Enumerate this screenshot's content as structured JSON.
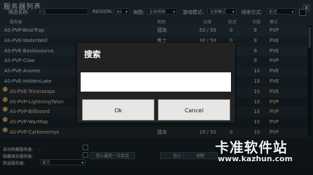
{
  "window": {
    "title": "服务器列表",
    "close_label": "X"
  },
  "filters": {
    "name_label": "筛选名称:",
    "name_placeholder": "筛选",
    "region_label": "REGION:",
    "region_value": "AS",
    "map_label": "地图:",
    "map_value": "全部地图",
    "mode_label": "游戏模式:",
    "mode_value": "全部模式",
    "sort_label": "排序方式:",
    "sort_value": "延迟"
  },
  "table": {
    "headers": {
      "server": "服务器",
      "map": "地图",
      "players": "玩家",
      "latency": "延迟",
      "days": "天数",
      "mode": "模式"
    },
    "rows": [
      {
        "name": "AS-PVP-BearTrap",
        "map": "孤岛",
        "players": "50 / 50",
        "latency": "0",
        "days": "9",
        "mode": "PVP",
        "official": false
      },
      {
        "name": "AS-PVE-WaterWell",
        "map": "焦土",
        "players": "30 / 50",
        "latency": "0",
        "days": "9",
        "mode": "PVE",
        "official": false
      },
      {
        "name": "AS-PVE-Basilosaurus",
        "map": "",
        "players": "",
        "latency": "",
        "days": "9",
        "mode": "PVE",
        "official": false
      },
      {
        "name": "AS-PVP-Claw",
        "map": "",
        "players": "",
        "latency": "",
        "days": "9",
        "mode": "PVP",
        "official": false
      },
      {
        "name": "AS-PVE-Araneo",
        "map": "",
        "players": "",
        "latency": "",
        "days": "10",
        "mode": "PVE",
        "official": false
      },
      {
        "name": "AS-PVE-HiddenLake",
        "map": "",
        "players": "",
        "latency": "",
        "days": "10",
        "mode": "PVE",
        "official": false
      },
      {
        "name": "AS-PVE-Triceratops",
        "map": "",
        "players": "",
        "latency": "",
        "days": "10",
        "mode": "PVE",
        "official": true
      },
      {
        "name": "AS-PVP-LightningTalon",
        "map": "",
        "players": "",
        "latency": "",
        "days": "10",
        "mode": "PVP",
        "official": true
      },
      {
        "name": "AS-PVP-Billboard",
        "map": "",
        "players": "",
        "latency": "",
        "days": "10",
        "mode": "PVP",
        "official": true
      },
      {
        "name": "AS-PVP-WarMap",
        "map": "",
        "players": "",
        "latency": "",
        "days": "10",
        "mode": "PVP",
        "official": true
      },
      {
        "name": "AS-PVP-Carbonemys",
        "map": "孤岛",
        "players": "19 / 50",
        "latency": "0",
        "days": "10",
        "mode": "PVP",
        "official": true
      }
    ]
  },
  "bottom": {
    "auto_label": "自动收藏服务器:",
    "auto_value": "...",
    "hidden_label": "隐藏满员服务器:",
    "filter_label": "筛选服务器:",
    "filter_value": "官方",
    "join_last_label": "加入最后一次会话",
    "join_label": "加入",
    "refresh_label": "刷新"
  },
  "dialog": {
    "title": "搜索",
    "input_value": "",
    "ok_label": "Ok",
    "cancel_label": "Cancel"
  },
  "watermark": {
    "text": "卡准软件站",
    "url": "www.kazhun.com"
  }
}
